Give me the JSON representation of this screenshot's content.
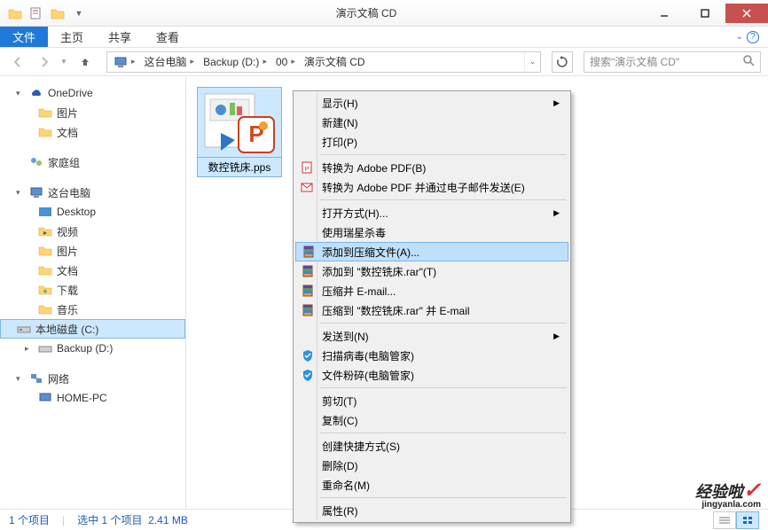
{
  "window": {
    "title": "演示文稿 CD"
  },
  "menu": {
    "file": "文件",
    "home": "主页",
    "share": "共享",
    "view": "查看"
  },
  "breadcrumb": {
    "root_icon": "pc",
    "items": [
      "这台电脑",
      "Backup (D:)",
      "00",
      "演示文稿 CD"
    ]
  },
  "search": {
    "placeholder": "搜索\"演示文稿 CD\""
  },
  "sidebar": {
    "onedrive": {
      "label": "OneDrive",
      "children": [
        "图片",
        "文档"
      ]
    },
    "homegroup": {
      "label": "家庭组"
    },
    "thispc": {
      "label": "这台电脑",
      "children": [
        "Desktop",
        "视频",
        "图片",
        "文档",
        "下载",
        "音乐",
        "本地磁盘 (C:)",
        "Backup (D:)"
      ]
    },
    "network": {
      "label": "网络",
      "children": [
        "HOME-PC"
      ]
    }
  },
  "file": {
    "name": "数控铣床.pps"
  },
  "context_menu": {
    "items": [
      {
        "label": "显示(H)",
        "submenu": true
      },
      {
        "label": "新建(N)"
      },
      {
        "label": "打印(P)"
      },
      {
        "sep": true
      },
      {
        "label": "转换为 Adobe PDF(B)",
        "icon": "pdf"
      },
      {
        "label": "转换为 Adobe PDF 并通过电子邮件发送(E)",
        "icon": "pdf-mail"
      },
      {
        "sep": true
      },
      {
        "label": "打开方式(H)...",
        "submenu": true
      },
      {
        "label": "使用瑞星杀毒"
      },
      {
        "label": "添加到压缩文件(A)...",
        "icon": "rar",
        "highlight": true
      },
      {
        "label": "添加到 \"数控铣床.rar\"(T)",
        "icon": "rar"
      },
      {
        "label": "压缩并 E-mail...",
        "icon": "rar"
      },
      {
        "label": "压缩到 \"数控铣床.rar\" 并 E-mail",
        "icon": "rar"
      },
      {
        "sep": true
      },
      {
        "label": "发送到(N)",
        "submenu": true
      },
      {
        "label": "扫描病毒(电脑管家)",
        "icon": "shield"
      },
      {
        "label": "文件粉碎(电脑管家)",
        "icon": "shield"
      },
      {
        "sep": true
      },
      {
        "label": "剪切(T)"
      },
      {
        "label": "复制(C)"
      },
      {
        "sep": true
      },
      {
        "label": "创建快捷方式(S)"
      },
      {
        "label": "删除(D)"
      },
      {
        "label": "重命名(M)"
      },
      {
        "sep": true
      },
      {
        "label": "属性(R)"
      }
    ]
  },
  "statusbar": {
    "count": "1 个项目",
    "selection": "选中 1 个项目",
    "size": "2.41 MB"
  },
  "watermark": {
    "main": "经验啦",
    "sub": "jingyanla.com"
  }
}
